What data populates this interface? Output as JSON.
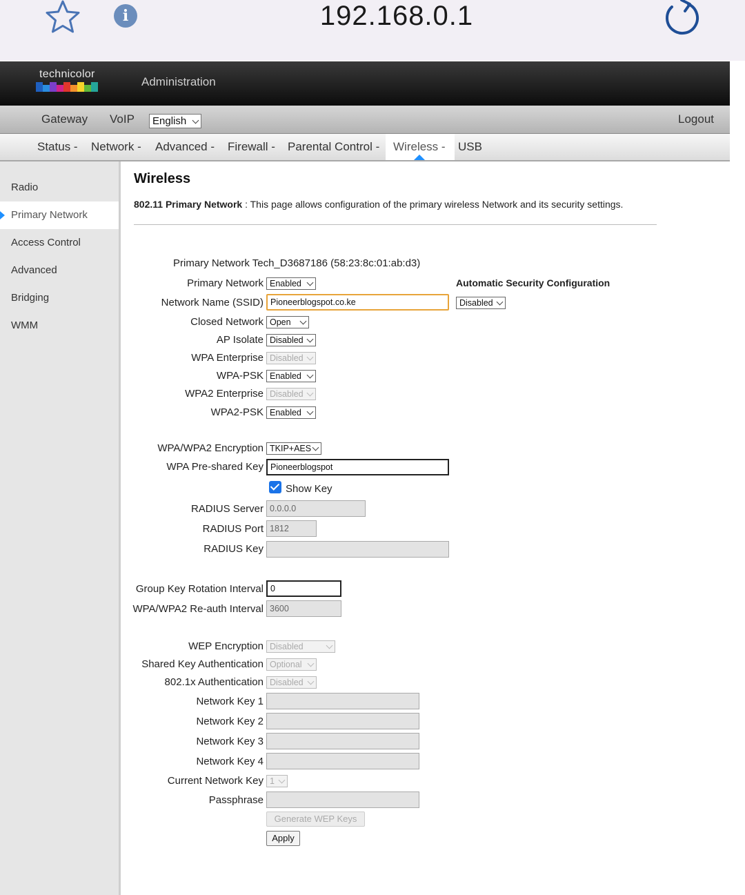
{
  "browser": {
    "url": "192.168.0.1",
    "star_icon": "star-icon",
    "info_icon": "info-icon",
    "info_glyph": "i",
    "reload_icon": "reload-icon"
  },
  "header": {
    "brand": "technicolor",
    "title": "Administration",
    "brand_colors": [
      "#1e5fbf",
      "#2a8de0",
      "#7a3fc9",
      "#d0238a",
      "#e0362b",
      "#f2912c",
      "#f5d42a",
      "#5fb83a",
      "#25a59a"
    ]
  },
  "top_nav": {
    "gateway": "Gateway",
    "voip": "VoIP",
    "language": "English",
    "logout": "Logout"
  },
  "sub_nav": {
    "status": "Status -",
    "network": "Network -",
    "advanced": "Advanced -",
    "firewall": "Firewall -",
    "parental": "Parental Control -",
    "wireless": "Wireless -",
    "usb": "USB",
    "active": "Wireless -"
  },
  "sidebar": {
    "items": [
      "Radio",
      "Primary Network",
      "Access Control",
      "Advanced",
      "Bridging",
      "WMM"
    ],
    "selected": "Primary Network",
    "accent_color": "#1e90ff"
  },
  "page": {
    "title": "Wireless",
    "desc_bold": "802.11 Primary Network",
    "desc_text": " :  This page allows configuration of the primary wireless Network and its security settings."
  },
  "form": {
    "network_header": "Primary Network Tech_D3687186 (58:23:8c:01:ab:d3)",
    "auto_sec_label": "Automatic Security Configuration",
    "auto_sec_value": "Disabled",
    "primary_network": {
      "label": "Primary Network",
      "value": "Enabled"
    },
    "ssid": {
      "label": "Network Name (SSID)",
      "value": "Pioneerblogspot.co.ke"
    },
    "closed_network": {
      "label": "Closed Network",
      "value": "Open"
    },
    "ap_isolate": {
      "label": "AP Isolate",
      "value": "Disabled"
    },
    "wpa_enterprise": {
      "label": "WPA Enterprise",
      "value": "Disabled"
    },
    "wpa_psk": {
      "label": "WPA-PSK",
      "value": "Enabled"
    },
    "wpa2_enterprise": {
      "label": "WPA2 Enterprise",
      "value": "Disabled"
    },
    "wpa2_psk": {
      "label": "WPA2-PSK",
      "value": "Enabled"
    },
    "encryption": {
      "label": "WPA/WPA2 Encryption",
      "value": "TKIP+AES"
    },
    "psk": {
      "label": "WPA Pre-shared Key",
      "value": "Pioneerblogspot"
    },
    "show_key": {
      "label": "Show Key",
      "checked": true
    },
    "radius_server": {
      "label": "RADIUS Server",
      "value": "0.0.0.0"
    },
    "radius_port": {
      "label": "RADIUS Port",
      "value": "1812"
    },
    "radius_key": {
      "label": "RADIUS Key",
      "value": ""
    },
    "group_key": {
      "label": "Group Key Rotation Interval",
      "value": "0"
    },
    "reauth": {
      "label": "WPA/WPA2 Re-auth Interval",
      "value": "3600"
    },
    "wep_encryption": {
      "label": "WEP Encryption",
      "value": "Disabled"
    },
    "shared_key_auth": {
      "label": "Shared Key Authentication",
      "value": "Optional"
    },
    "dot1x_auth": {
      "label": "802.1x Authentication",
      "value": "Disabled"
    },
    "network_key_1": {
      "label": "Network Key 1",
      "value": ""
    },
    "network_key_2": {
      "label": "Network Key 2",
      "value": ""
    },
    "network_key_3": {
      "label": "Network Key 3",
      "value": ""
    },
    "network_key_4": {
      "label": "Network Key 4",
      "value": ""
    },
    "current_key": {
      "label": "Current Network Key",
      "value": "1"
    },
    "passphrase": {
      "label": "Passphrase",
      "value": ""
    },
    "generate_wep": "Generate WEP Keys",
    "apply": "Apply"
  }
}
